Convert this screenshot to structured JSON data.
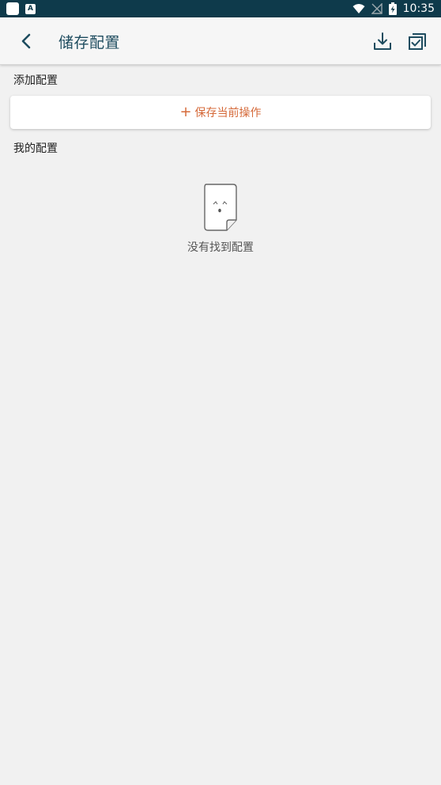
{
  "status_bar": {
    "time": "10:35",
    "notif_a": "A"
  },
  "header": {
    "title": "储存配置"
  },
  "sections": {
    "add_label": "添加配置",
    "save_button": {
      "plus": "+",
      "label": "保存当前操作"
    },
    "mine_label": "我的配置"
  },
  "empty_state": {
    "message": "没有找到配置"
  },
  "colors": {
    "status_bar_bg": "#0e3a4b",
    "title": "#1e4c5f",
    "accent_orange": "#d56a3a",
    "page_bg": "#f1f1f1"
  },
  "icons": {
    "back": "back-arrow-icon",
    "download": "download-icon",
    "select_all": "check-box-icon",
    "empty": "empty-document-icon"
  }
}
